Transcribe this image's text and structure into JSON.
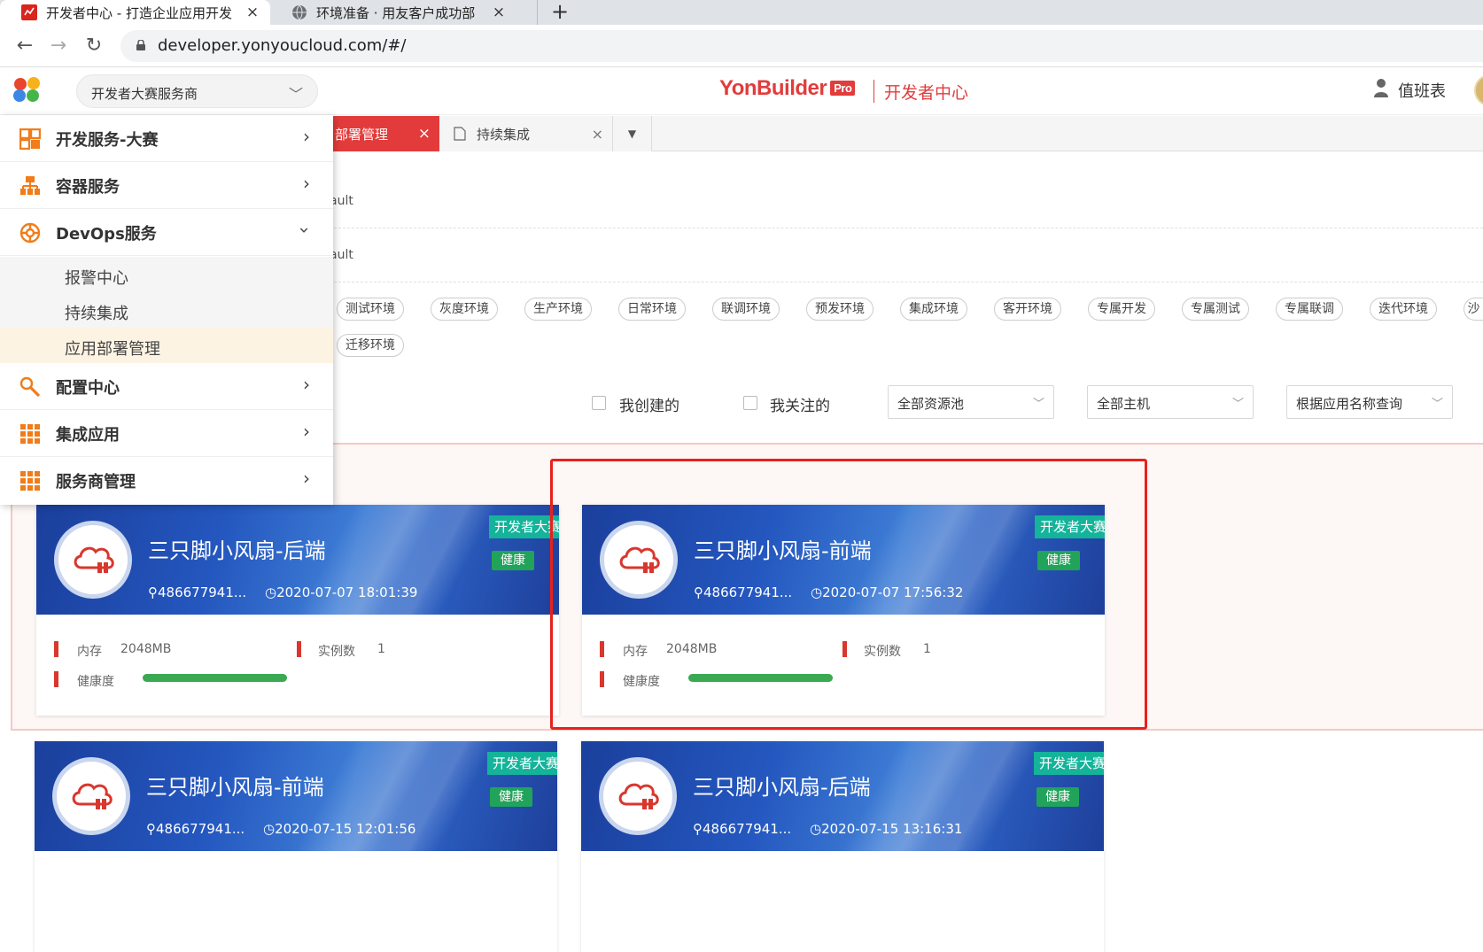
{
  "browser": {
    "tabs": [
      {
        "title": "开发者中心 - 打造企业应用开发",
        "close": "×"
      },
      {
        "title": "环境准备 · 用友客户成功部",
        "close": "×"
      }
    ],
    "new_tab": "+",
    "url": "developer.yonyoucloud.com/#/"
  },
  "header": {
    "tenant_select": "开发者大赛服务商",
    "brand": "YonBuilder",
    "brand_badge": "Pro",
    "center_title": "开发者中心",
    "duty_label": "值班表"
  },
  "page_tabs": [
    {
      "label": "部署管理",
      "close": "×"
    },
    {
      "label": "持续集成",
      "close": "×"
    }
  ],
  "filters": {
    "row1_value": "ault",
    "row2_value": "ault",
    "env_tags": [
      "测试环境",
      "灰度环境",
      "生产环境",
      "日常环境",
      "联调环境",
      "预发环境",
      "集成环境",
      "客开环境",
      "专属开发",
      "专属测试",
      "专属联调",
      "迭代环境",
      "沙",
      "迁移环境"
    ],
    "my_created": "我创建的",
    "my_followed": "我关注的",
    "resource_pool": "全部资源池",
    "host": "全部主机",
    "search_by_name": "根据应用名称查询"
  },
  "menu": {
    "items": [
      {
        "label": "开发服务-大赛",
        "icon": "dashboard-grid-icon"
      },
      {
        "label": "容器服务",
        "icon": "container-network-icon"
      },
      {
        "label": "DevOps服务",
        "icon": "devops-gear-icon"
      },
      {
        "label": "配置中心",
        "icon": "wrench-icon"
      },
      {
        "label": "集成应用",
        "icon": "apps-grid-icon"
      },
      {
        "label": "服务商管理",
        "icon": "apps-grid-icon"
      }
    ],
    "devops_sub": [
      "报警中心",
      "持续集成",
      "应用部署管理"
    ]
  },
  "cards": [
    {
      "name": "三只脚小风扇-后端",
      "owner": "486677941...",
      "time": "2020-07-07 18:01:39",
      "ribbon": "开发者大赛",
      "status": "健康",
      "mem_label": "内存",
      "mem": "2048MB",
      "inst_label": "实例数",
      "inst": "1",
      "health_label": "健康度"
    },
    {
      "name": "三只脚小风扇-前端",
      "owner": "486677941...",
      "time": "2020-07-07 17:56:32",
      "ribbon": "开发者大赛",
      "status": "健康",
      "mem_label": "内存",
      "mem": "2048MB",
      "inst_label": "实例数",
      "inst": "1",
      "health_label": "健康度"
    },
    {
      "name": "三只脚小风扇-前端",
      "owner": "486677941...",
      "time": "2020-07-15 12:01:56",
      "ribbon": "开发者大赛",
      "status": "健康"
    },
    {
      "name": "三只脚小风扇-后端",
      "owner": "486677941...",
      "time": "2020-07-15 13:16:31",
      "ribbon": "开发者大赛",
      "status": "健康"
    }
  ],
  "colors": {
    "accent": "#e33b3b",
    "health": "#21a35a",
    "ribbon": "#14b39a",
    "highlight_box": "#e8211d"
  }
}
